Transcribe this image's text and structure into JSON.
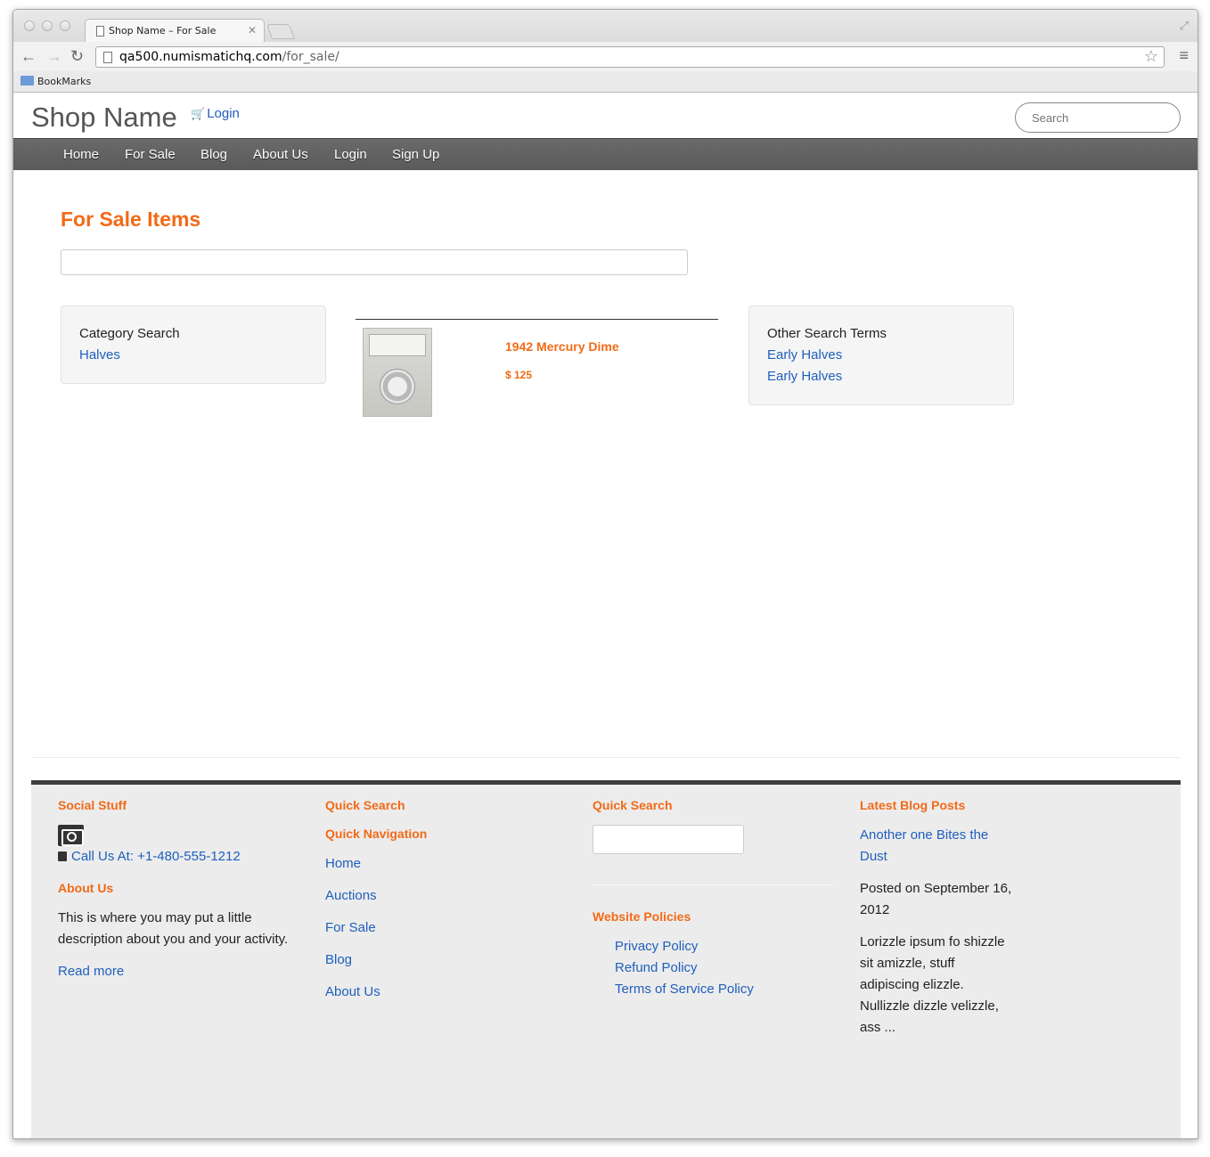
{
  "browser": {
    "tab_title": "Shop Name – For Sale",
    "url_host": "qa500.numismatichq.com",
    "url_path": "/for_sale/",
    "bookmarks_label": "BookMarks"
  },
  "header": {
    "brand": "Shop Name",
    "cart_login": "Login",
    "search_placeholder": "Search"
  },
  "nav": [
    "Home",
    "For Sale",
    "Blog",
    "About Us",
    "Login",
    "Sign Up"
  ],
  "main": {
    "title": "For Sale Items",
    "category_search": {
      "title": "Category Search",
      "links": [
        "Halves"
      ]
    },
    "item": {
      "name": "1942 Mercury Dime",
      "price": "$ 125"
    },
    "other_search": {
      "title": "Other Search Terms",
      "links": [
        "Early Halves",
        "Early Halves"
      ]
    }
  },
  "footer": {
    "col1": {
      "social_heading": "Social Stuff",
      "phone": "Call Us At: +1-480-555-1212",
      "about_heading": "About Us",
      "about_line1": "This is where you may put a little",
      "about_line2": "description about you and your activity.",
      "read_more": "Read more"
    },
    "col2": {
      "quick_search_heading": "Quick Search",
      "quick_nav_heading": "Quick Navigation",
      "links": [
        "Home",
        "Auctions",
        "For Sale",
        "Blog",
        "About Us"
      ]
    },
    "col3": {
      "quick_search_heading": "Quick Search",
      "policies_heading": "Website Policies",
      "policies": [
        "Privacy Policy",
        "Refund Policy",
        "Terms of Service Policy"
      ]
    },
    "col4": {
      "heading": "Latest Blog Posts",
      "post_title_line1": "Another one Bites the",
      "post_title_line2": "Dust",
      "posted_line1": "Posted on September 16,",
      "posted_line2": "2012",
      "excerpt_lines": [
        "Lorizzle ipsum fo shizzle",
        "sit amizzle, stuff",
        "adipiscing elizzle.",
        "Nullizzle dizzle velizzle,",
        "ass ..."
      ]
    }
  },
  "colors": {
    "accent": "#f26a17",
    "link": "#1f5fbd",
    "navbar": "#5f5f5f"
  }
}
